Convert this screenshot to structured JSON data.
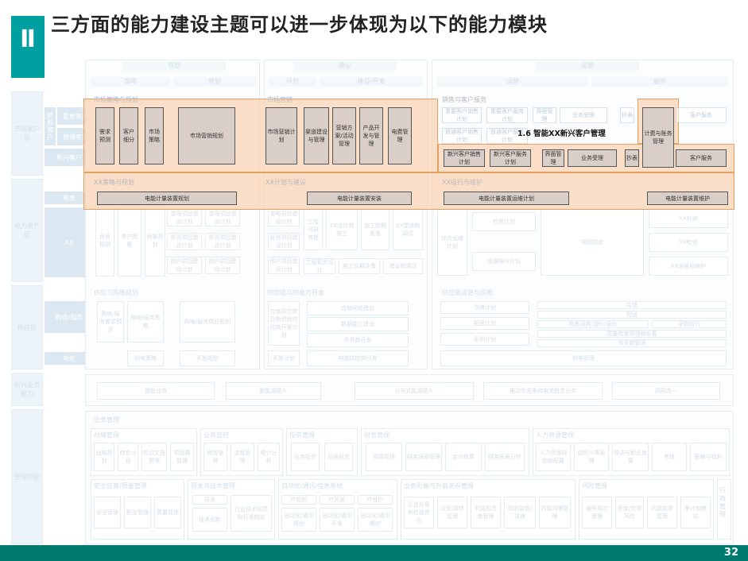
{
  "title": {
    "marker": "Ⅱ",
    "text": "三方面的能力建设主题可以进一步体现为以下的能力模块"
  },
  "page_number": "32",
  "colors": {
    "accent": "#00a0a0",
    "footer": "#007a70",
    "highlight_fill": "#f8cba5",
    "highlight_border": "#e8a060",
    "faded_box": "#cfe2ef"
  },
  "rows": {
    "market": "市场客户层",
    "power": "电力资产层",
    "supply": "供应层",
    "new_business": "新兴业务能力",
    "management": "管理职能"
  },
  "subrows": {
    "major": "重要客户",
    "ordinary": "普通客户",
    "special": "特殊客户",
    "new_customer": "新兴客户",
    "meter": "电表",
    "xx": "XX",
    "buy": "购电/服务",
    "sell": "电能"
  },
  "columns": {
    "plan": "规划",
    "build": "建设",
    "operate": "运营",
    "strategy": "策略",
    "plan2": "规划",
    "plan_sub": "计划",
    "build_dev": "建设/开发",
    "operate_sub": "运营",
    "service": "服务"
  },
  "market_row": {
    "plan_title": "市场策略与规划",
    "plan_items": [
      "需求预测",
      "客户细分",
      "市场策略",
      "市场营销规划"
    ],
    "build_title": "市场营销",
    "build_items": [
      "市场营销计划",
      "渠道建设与管理",
      "营销方案/活动管理",
      "产品开发与管理",
      "电费管理"
    ],
    "ops_title": "销售与客户服务",
    "ops_top": [
      "重要客户销售计划",
      "重要客户服务计划",
      "界面管理",
      "业务受理",
      "抄表",
      "客户服务"
    ],
    "ops_mid": [
      "普通客户销售计划",
      "普通客户服务计划"
    ],
    "ops_new": [
      "新兴客户销售计划",
      "新兴客户服务计划",
      "界面管理",
      "业务受理",
      "抄表",
      "客户服务"
    ],
    "billing": "计费与账务管理"
  },
  "meter_row": {
    "plan_title": "XX策略与规划",
    "plan_item": "电能计量装置规划",
    "build_title": "XX计划与建设",
    "build_item": "电能计量装置安装",
    "ops_title": "XX运行与维护",
    "ops_item1": "电能计量装置运维计划",
    "ops_item2": "电能计量装置维护"
  },
  "callout": "1.6 智能XX新兴客户管理",
  "power_row": {
    "plan": [
      "负荷预测",
      "资产策略",
      "网架规划",
      "变电项目建设计划",
      "变电项目建设计划",
      "投资项目建设计划",
      "投资项目建设计划",
      "用户项目建设计划",
      "用户项目建设计划"
    ],
    "build": [
      "变电项目建设计划",
      "投资项目建设计划",
      "用户项目建设计划",
      "工程可研审批",
      "XX设计和施工",
      "施工前期准备",
      "XX建设和调试",
      "工程初步设计",
      "施工前期准备",
      "建设和调试"
    ],
    "ops": [
      "综合运维计划",
      "检修计划",
      "运维操作计划",
      "电网调度",
      "XX检修",
      "XX检修",
      "XX运维和维护"
    ]
  },
  "supply_row": {
    "plan_title": "供应与购电规划",
    "plan": [
      "购电/服务需求预测",
      "购电/服务策略",
      "购电/服务供应规划",
      "购电策略",
      "开发规划"
    ],
    "build_title": "供应链与供电方开发",
    "build": [
      "合格供应商及物资和供应商开发计划",
      "合格网络建设",
      "数据能力建设",
      "供货商开发",
      "开发计划",
      "电能供应商开发"
    ],
    "ops_title": "供应链运营与购电",
    "ops": [
      "合储计划",
      "配送计划",
      "采购计划",
      "合储",
      "配送",
      "物资采购/询价/竞价",
      "采购执行",
      "质量检查管理和处置",
      "供货商管理",
      "购电管理"
    ]
  },
  "new_business_row": [
    "储能业务",
    "新能源接入",
    "分布式能源接入",
    "电动车充电和电池租赁业务",
    "四网合一"
  ],
  "management": {
    "title": "业务管理",
    "groups": [
      {
        "title": "战略管理",
        "items": [
          "战略规划",
          "综合计划",
          "知识文档管理",
          "项目群管理"
        ]
      },
      {
        "title": "业务监控",
        "items": [
          "绩效管理",
          "流程管理",
          "统计分析"
        ]
      },
      {
        "title": "投资管理",
        "items": [
          "业务投资",
          "后续投资"
        ]
      },
      {
        "title": "财务管理",
        "items": [
          "预算管理",
          "财务运营管理",
          "会计核算",
          "财务报表分析"
        ]
      },
      {
        "title": "人力资源管理",
        "items": [
          "人力资源规划和配置",
          "组织人事管理",
          "培训与职业发展",
          "考核",
          "薪酬与福利"
        ]
      },
      {
        "title": "安全监察/质量管理",
        "items": [
          "安全管理",
          "职业管理",
          "质量管理"
        ]
      },
      {
        "title": "研发与技术管理",
        "items": [
          "研发",
          "技术创新",
          "行业技术规范和标准制定"
        ]
      },
      {
        "title": "自动化/通讯/信息系统",
        "items": [
          "IT规划",
          "IT开发",
          "IT维护",
          "自动化/通讯规划",
          "自动化/通讯开发",
          "自动化/通讯维护"
        ]
      },
      {
        "title": "业务形象与外部关系管理",
        "items": [
          "企业形象和社会责任",
          "公关/媒体管理",
          "利益相关者管理",
          "政府监管/法律",
          "内部沟通管理"
        ]
      },
      {
        "title": "风险管理",
        "items": [
          "操作风险管理",
          "资金/信用风险",
          "内部监督管理",
          "审计和稽核"
        ]
      },
      {
        "title": "行政管理",
        "items": []
      }
    ]
  }
}
